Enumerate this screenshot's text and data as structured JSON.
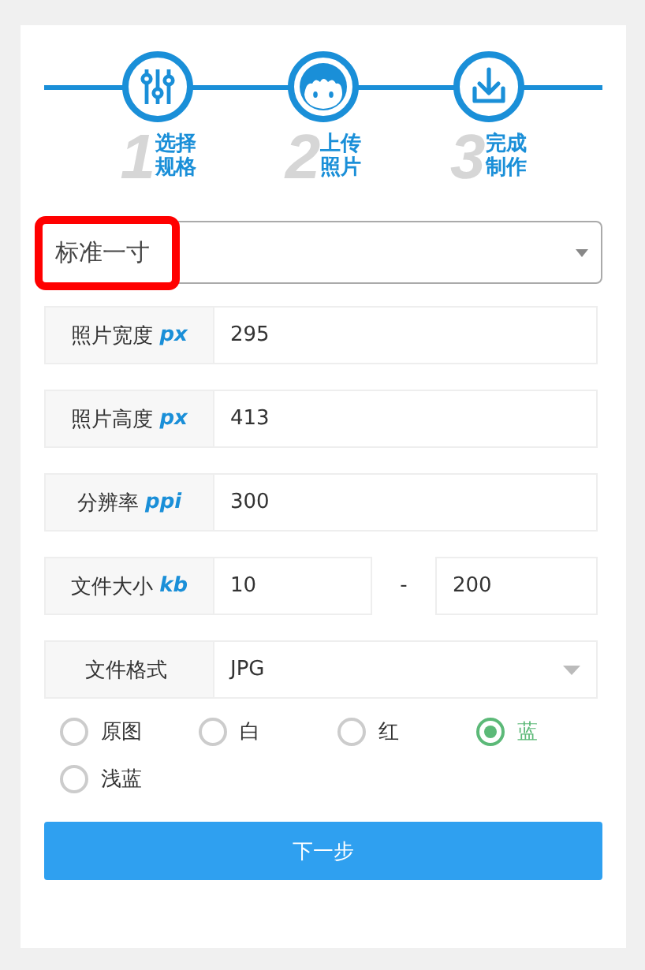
{
  "steps": [
    {
      "kind": "sliders",
      "number": "1",
      "line1": "选择",
      "line2": "规格"
    },
    {
      "kind": "face",
      "number": "2",
      "line1": "上传",
      "line2": "照片"
    },
    {
      "kind": "download",
      "number": "3",
      "line1": "完成",
      "line2": "制作"
    }
  ],
  "size_select": {
    "value": "标准一寸",
    "highlighted": true
  },
  "fields": [
    {
      "kind": "input",
      "label": "照片宽度",
      "unit": "px",
      "value": "295"
    },
    {
      "kind": "input",
      "label": "照片高度",
      "unit": "px",
      "value": "413"
    },
    {
      "kind": "input",
      "label": "分辨率",
      "unit": "ppi",
      "value": "300"
    },
    {
      "kind": "range",
      "label": "文件大小",
      "unit": "kb",
      "from": "10",
      "separator": "-",
      "to": "200"
    },
    {
      "kind": "select",
      "label": "文件格式",
      "value": "JPG"
    }
  ],
  "backgrounds": [
    {
      "label": "原图",
      "selected": false
    },
    {
      "label": "白",
      "selected": false
    },
    {
      "label": "红",
      "selected": false
    },
    {
      "label": "蓝",
      "selected": true
    },
    {
      "label": "浅蓝",
      "selected": false
    }
  ],
  "next_button": "下一步"
}
